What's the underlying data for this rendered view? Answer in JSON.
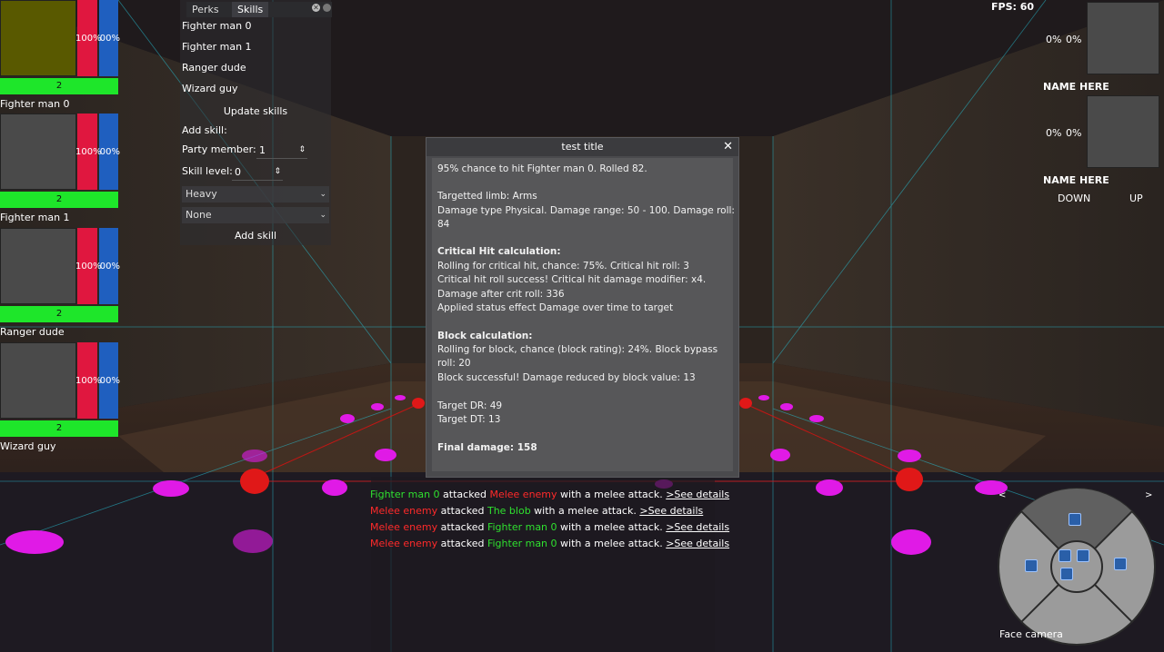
{
  "fps": "FPS: 60",
  "colors": {
    "hp": "#e0173f",
    "mp": "#1f5fbf",
    "stamina": "#1ee62a",
    "ally": "#2fe02f",
    "enemy": "#ff2a2a"
  },
  "party": [
    {
      "name": "Fighter man 0",
      "hp": "100%",
      "mp": "100%",
      "level": "2",
      "portrait_color": "#595900"
    },
    {
      "name": "Fighter man 1",
      "hp": "100%",
      "mp": "100%",
      "level": "2",
      "portrait_color": "#4a4a4a"
    },
    {
      "name": "Ranger dude",
      "hp": "100%",
      "mp": "100%",
      "level": "2",
      "portrait_color": "#4a4a4a"
    },
    {
      "name": "Wizard guy",
      "hp": "100%",
      "mp": "100%",
      "level": "2",
      "portrait_color": "#4a4a4a"
    }
  ],
  "skills_panel": {
    "tabs": [
      "Perks",
      "Skills"
    ],
    "members": [
      "Fighter man 0",
      "Fighter man 1",
      "Ranger dude",
      "Wizard guy"
    ],
    "update_label": "Update skills",
    "add_skill_label": "Add skill:",
    "party_member_label": "Party member:",
    "party_member_value": "1",
    "skill_level_label": "Skill level:",
    "skill_level_value": "0",
    "select1": "Heavy",
    "select2": "None",
    "add_button": "Add skill"
  },
  "dialog": {
    "title": "test title",
    "lines": [
      {
        "t": "95% chance to hit Fighter man 0. Rolled 82.",
        "b": false
      },
      {
        "t": "Targetted limb: Arms",
        "b": false
      },
      {
        "t": "Damage type Physical. Damage range: 50 - 100. Damage roll:",
        "b": false
      },
      {
        "t": "84",
        "b": false
      },
      {
        "t": "Critical Hit calculation:",
        "b": true
      },
      {
        "t": "Rolling for critical hit, chance: 75%. Critical hit roll: 3",
        "b": false
      },
      {
        "t": "Critical hit roll success! Critical hit damage modifier: x4.",
        "b": false
      },
      {
        "t": "Damage after crit roll: 336",
        "b": false
      },
      {
        "t": "Applied status effect Damage over time to target",
        "b": false
      },
      {
        "t": "Block calculation:",
        "b": true
      },
      {
        "t": "Rolling for block, chance (block rating): 24%. Block bypass",
        "b": false
      },
      {
        "t": "roll: 20",
        "b": false
      },
      {
        "t": "Block successful! Damage reduced by block value: 13",
        "b": false
      },
      {
        "t": "Target DR: 49",
        "b": false
      },
      {
        "t": "Target DT: 13",
        "b": false
      },
      {
        "t": "Final damage: 158",
        "b": true
      }
    ]
  },
  "combat_log": [
    {
      "attacker": "Fighter man 0",
      "attacker_side": "ally",
      "verb": " attacked ",
      "target": "Melee enemy",
      "target_side": "enemy",
      "rest": " with a melee attack. ",
      "link": ">See details"
    },
    {
      "attacker": "Melee enemy",
      "attacker_side": "enemy",
      "verb": " attacked ",
      "target": "The blob",
      "target_side": "ally",
      "rest": " with a melee attack. ",
      "link": ">See details"
    },
    {
      "attacker": "Melee enemy",
      "attacker_side": "enemy",
      "verb": " attacked ",
      "target": "Fighter man 0",
      "target_side": "ally",
      "rest": " with a melee attack. ",
      "link": ">See details"
    },
    {
      "attacker": "Melee enemy",
      "attacker_side": "enemy",
      "verb": " attacked ",
      "target": "Fighter man 0",
      "target_side": "ally",
      "rest": " with a melee attack. ",
      "link": ">See details"
    }
  ],
  "npc_panels": [
    {
      "pct1": "0%",
      "pct2": "0%",
      "name": "NAME HERE"
    },
    {
      "pct1": "0%",
      "pct2": "0%",
      "name": "NAME HERE"
    }
  ],
  "npc_controls": {
    "down": "DOWN",
    "up": "UP"
  },
  "compass": {
    "left_arrow": "<",
    "right_arrow": ">",
    "face_camera": "Face camera"
  }
}
